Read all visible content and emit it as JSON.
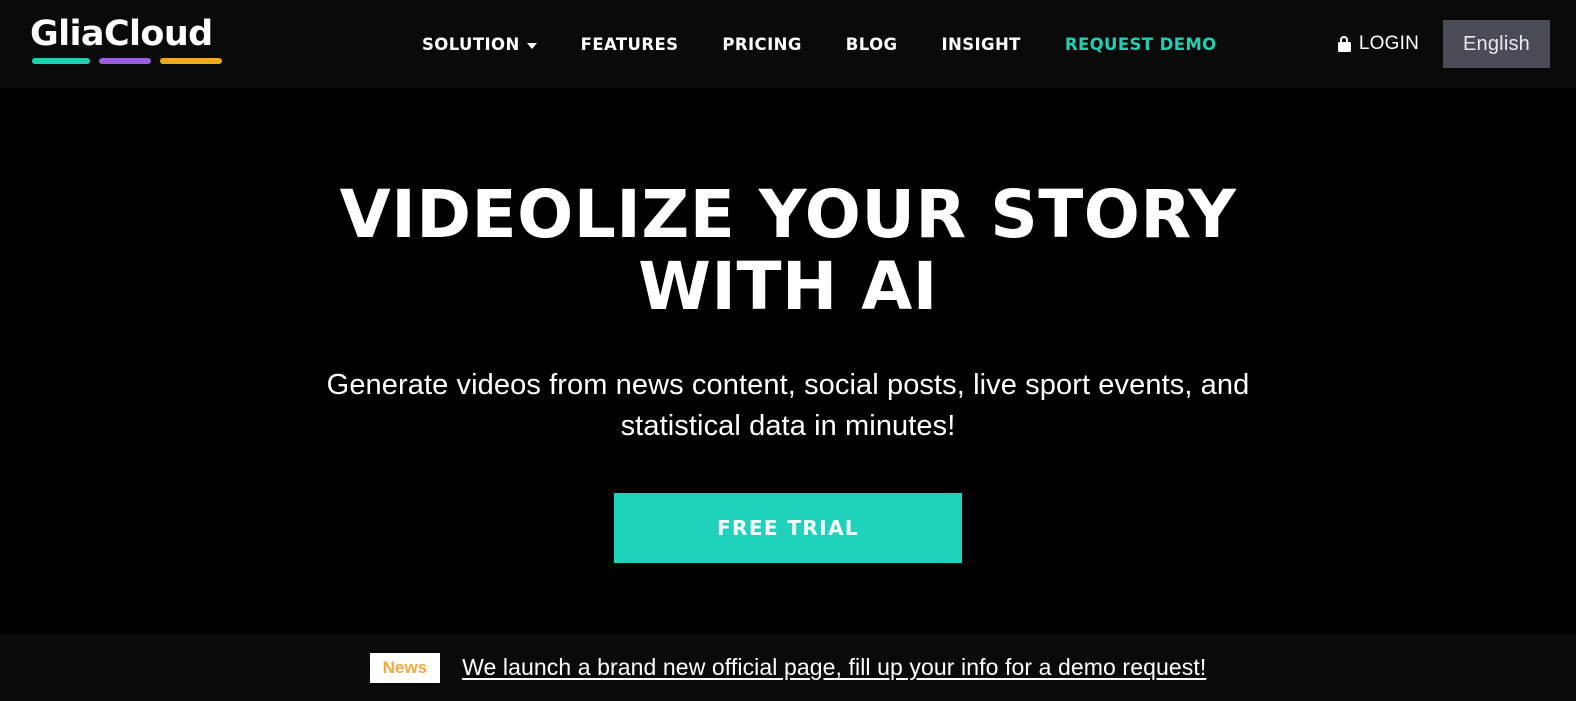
{
  "colors": {
    "background": "#000000",
    "header_background": "#0a0a0a",
    "accent_teal": "#1ed0b4",
    "cta_teal": "#1ed2bb",
    "logo_bar_teal": "#1fd1b0",
    "logo_bar_purple": "#9b5de5",
    "logo_bar_orange": "#f5a623",
    "lang_button_bg": "#4b4b56",
    "news_badge_text": "#f5a93c"
  },
  "header": {
    "brand": {
      "name": "GliaCloud",
      "bars": [
        "teal-bar",
        "purple-bar",
        "orange-bar"
      ]
    },
    "nav": [
      {
        "label": "SOLUTION",
        "has_dropdown": true,
        "accent": false,
        "icon": "chevron-down-icon"
      },
      {
        "label": "FEATURES",
        "has_dropdown": false,
        "accent": false
      },
      {
        "label": "PRICING",
        "has_dropdown": false,
        "accent": false
      },
      {
        "label": "BLOG",
        "has_dropdown": false,
        "accent": false
      },
      {
        "label": "INSIGHT",
        "has_dropdown": false,
        "accent": false
      },
      {
        "label": "REQUEST DEMO",
        "has_dropdown": false,
        "accent": true
      }
    ],
    "login": {
      "label": "LOGIN",
      "icon": "lock-icon"
    },
    "language": {
      "selected": "English"
    }
  },
  "hero": {
    "title": "VIDEOLIZE YOUR STORY WITH AI",
    "subtitle": "Generate videos from news content, social posts, live sport events, and statistical data in minutes!",
    "cta_label": "FREE TRIAL"
  },
  "news_bar": {
    "badge": "News",
    "link_text": "We launch a brand new official page, fill up your info for a demo request!"
  }
}
